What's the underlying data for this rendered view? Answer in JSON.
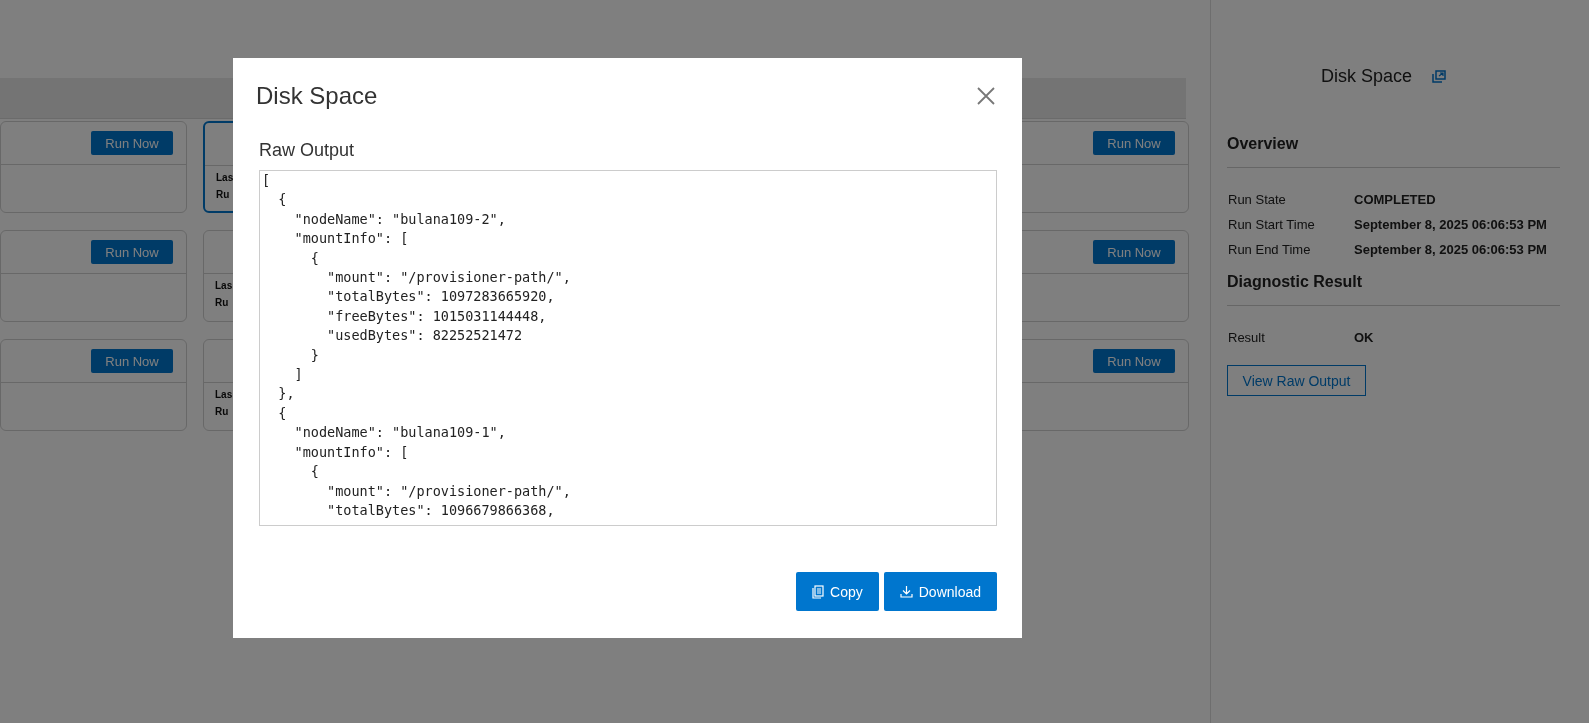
{
  "card_rows": [
    {
      "cards": [
        {
          "kind": "run",
          "button": "Run Now",
          "selected": false
        },
        {
          "kind": "info",
          "labels": [
            "Las",
            "Ru"
          ],
          "selected": true
        },
        {
          "kind": "run",
          "button": "Run Now",
          "selected": false
        }
      ]
    },
    {
      "cards": [
        {
          "kind": "run",
          "button": "Run Now",
          "selected": false
        },
        {
          "kind": "info",
          "labels": [
            "Las",
            "Ru"
          ],
          "selected": false
        },
        {
          "kind": "run",
          "button": "Run Now",
          "selected": false
        }
      ]
    },
    {
      "cards": [
        {
          "kind": "run",
          "button": "Run Now",
          "selected": false
        },
        {
          "kind": "info",
          "labels": [
            "Las",
            "Ru"
          ],
          "selected": false
        },
        {
          "kind": "run",
          "button": "Run Now",
          "selected": false
        }
      ]
    }
  ],
  "details_panel": {
    "title": "Disk Space",
    "sections": [
      {
        "heading": "Overview",
        "rows": [
          {
            "label": "Run State",
            "value": "COMPLETED"
          },
          {
            "label": "Run Start Time",
            "value": "September 8, 2025 06:06:53 PM"
          },
          {
            "label": "Run End Time",
            "value": "September 8, 2025 06:06:53 PM"
          }
        ]
      },
      {
        "heading": "Diagnostic Result",
        "rows": [
          {
            "label": "Result",
            "value": "OK"
          }
        ]
      }
    ],
    "button": "View Raw Output"
  },
  "dialog": {
    "title": "Disk Space",
    "field_label": "Raw Output",
    "raw_output": "[\n  {\n    \"nodeName\": \"bulana109-2\",\n    \"mountInfo\": [\n      {\n        \"mount\": \"/provisioner-path/\",\n        \"totalBytes\": 1097283665920,\n        \"freeBytes\": 1015031144448,\n        \"usedBytes\": 82252521472\n      }\n    ]\n  },\n  {\n    \"nodeName\": \"bulana109-1\",\n    \"mountInfo\": [\n      {\n        \"mount\": \"/provisioner-path/\",\n        \"totalBytes\": 1096679866368,",
    "buttons": [
      {
        "kind": "copy",
        "label": "Copy"
      },
      {
        "kind": "download",
        "label": "Download"
      }
    ]
  }
}
